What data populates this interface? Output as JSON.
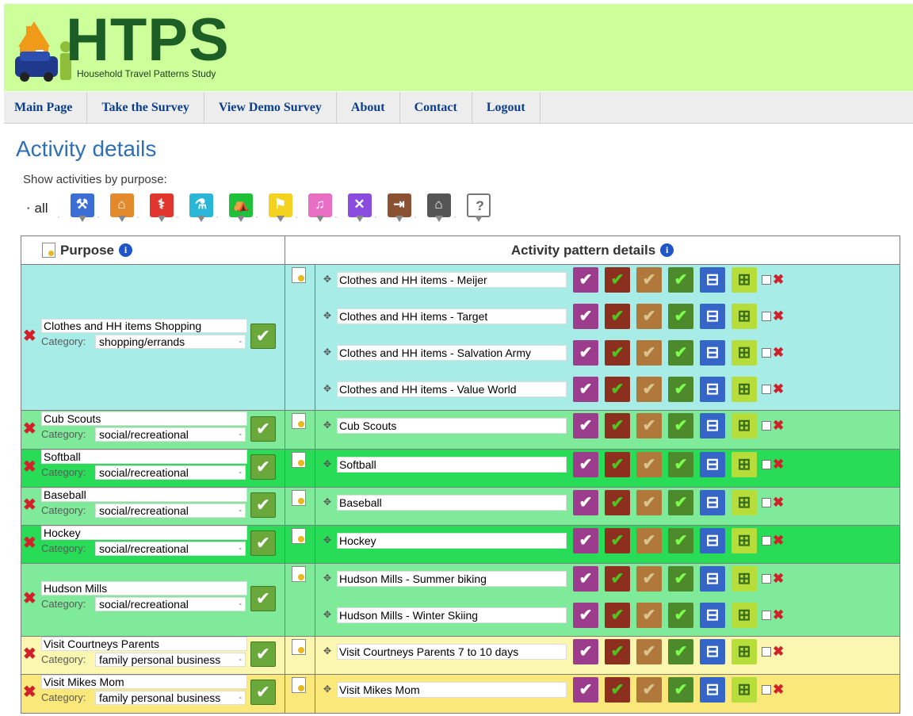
{
  "header": {
    "logo_text": "HTPS",
    "logo_subtitle": "Household Travel Patterns Study"
  },
  "nav": [
    "Main Page",
    "Take the Survey",
    "View Demo Survey",
    "About",
    "Contact",
    "Logout"
  ],
  "page_title": "Activity details",
  "filter": {
    "label": "Show activities by purpose:",
    "all_label": "all",
    "purposes": [
      {
        "icon": "work-icon",
        "color": "#3b6fd6",
        "glyph": "⚒"
      },
      {
        "icon": "school-icon",
        "color": "#e28a2c",
        "glyph": "⌂"
      },
      {
        "icon": "medical-icon",
        "color": "#e0362d",
        "glyph": "⚕"
      },
      {
        "icon": "personal-icon",
        "color": "#2ab6d6",
        "glyph": "⚗"
      },
      {
        "icon": "recreation-icon",
        "color": "#1fc03a",
        "glyph": "⛺"
      },
      {
        "icon": "family-icon",
        "color": "#f4d21f",
        "glyph": "⚑"
      },
      {
        "icon": "social-icon",
        "color": "#e76ec3",
        "glyph": "♫"
      },
      {
        "icon": "dining-icon",
        "color": "#8a4cdf",
        "glyph": "✕"
      },
      {
        "icon": "exit-icon",
        "color": "#8a5233",
        "glyph": "⇥"
      },
      {
        "icon": "home-icon",
        "color": "#555555",
        "glyph": "⌂"
      },
      {
        "icon": "unknown-icon",
        "color": "#ffffff",
        "glyph": "?"
      }
    ]
  },
  "table": {
    "purpose_header": "Purpose",
    "details_header": "Activity pattern details",
    "category_label": "Category:",
    "rows": [
      {
        "purpose": "Clothes and HH items Shopping",
        "category": "shopping/errands",
        "activities": [
          "Clothes and HH items - Meijer",
          "Clothes and HH items - Target",
          "Clothes and HH items - Salvation Army",
          "Clothes and HH items - Value World"
        ]
      },
      {
        "purpose": "Cub Scouts",
        "category": "social/recreational",
        "activities": [
          "Cub Scouts"
        ]
      },
      {
        "purpose": "Softball",
        "category": "social/recreational",
        "activities": [
          "Softball"
        ]
      },
      {
        "purpose": "Baseball",
        "category": "social/recreational",
        "activities": [
          "Baseball"
        ]
      },
      {
        "purpose": "Hockey",
        "category": "social/recreational",
        "activities": [
          "Hockey"
        ]
      },
      {
        "purpose": "Hudson Mills",
        "category": "social/recreational",
        "activities": [
          "Hudson Mills - Summer biking",
          "Hudson Mills - Winter Skiing"
        ]
      },
      {
        "purpose": "Visit Courtneys Parents",
        "category": "family personal business",
        "activities": [
          "Visit Courtneys Parents 7 to 10 days"
        ]
      },
      {
        "purpose": "Visit Mikes Mom",
        "category": "family personal business",
        "activities": [
          "Visit Mikes Mom"
        ]
      }
    ]
  },
  "colors": {
    "header_bg": "#ccff99",
    "logo_green": "#1d5e27",
    "nav_link": "#0b3e8c",
    "title_blue": "#2e6fb5",
    "row_cyan": "#a8ece8",
    "row_green_light": "#7eea9a",
    "row_green_bright": "#28dc57",
    "row_yellow_light": "#fbf7b0",
    "row_yellow": "#fbe87a"
  }
}
